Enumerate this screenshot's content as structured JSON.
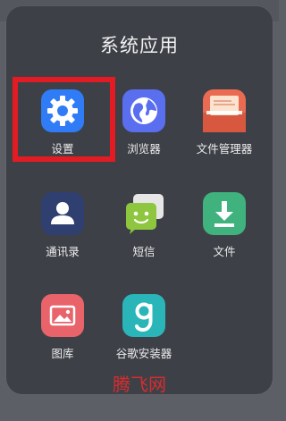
{
  "folder": {
    "title": "系统应用"
  },
  "apps": [
    {
      "label": "设置",
      "icon": "gear-icon",
      "color": "#2f7cf6"
    },
    {
      "label": "浏览器",
      "icon": "globe-icon",
      "color": "#5a6ef0"
    },
    {
      "label": "文件管理器",
      "icon": "folder-icon",
      "color": "#ea6b52"
    },
    {
      "label": "通讯录",
      "icon": "contact-icon",
      "color": "#2f3f6f"
    },
    {
      "label": "短信",
      "icon": "message-icon",
      "color": "#8ec63f"
    },
    {
      "label": "文件",
      "icon": "download-icon",
      "color": "#3fb27d"
    },
    {
      "label": "图库",
      "icon": "gallery-icon",
      "color": "#e8636a"
    },
    {
      "label": "谷歌安装器",
      "icon": "google-installer-icon",
      "color": "#2ab5b8"
    }
  ],
  "watermark": "腾飞网",
  "highlight_color": "#e31b23"
}
